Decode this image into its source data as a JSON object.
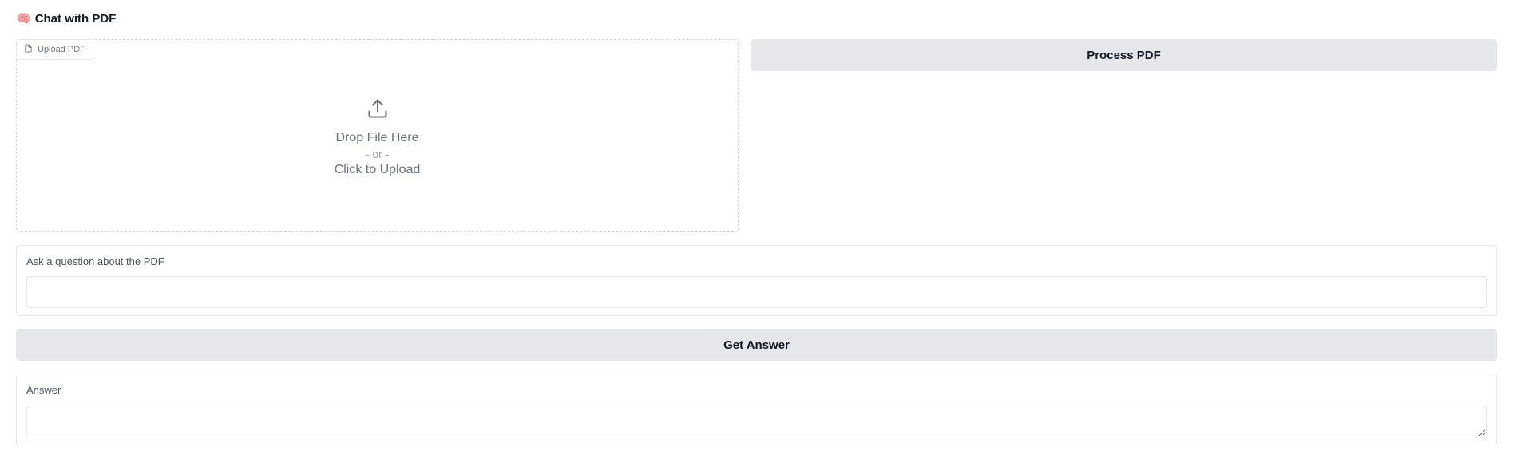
{
  "app": {
    "title_emoji": "🧠",
    "title": "Chat with PDF"
  },
  "upload": {
    "label": "Upload PDF",
    "label_icon": "file-icon",
    "upload_icon": "upload-icon",
    "drop_text": "Drop File Here",
    "or_text": "- or -",
    "click_text": "Click to Upload"
  },
  "process_button": {
    "label": "Process PDF"
  },
  "question": {
    "label": "Ask a question about the PDF",
    "value": "",
    "placeholder": ""
  },
  "answer_button": {
    "label": "Get Answer"
  },
  "answer": {
    "label": "Answer",
    "value": ""
  },
  "colors": {
    "button_bg": "#e5e7eb",
    "border": "#e5e7eb",
    "label_text": "#4b5563",
    "muted_text": "#6b7280"
  }
}
